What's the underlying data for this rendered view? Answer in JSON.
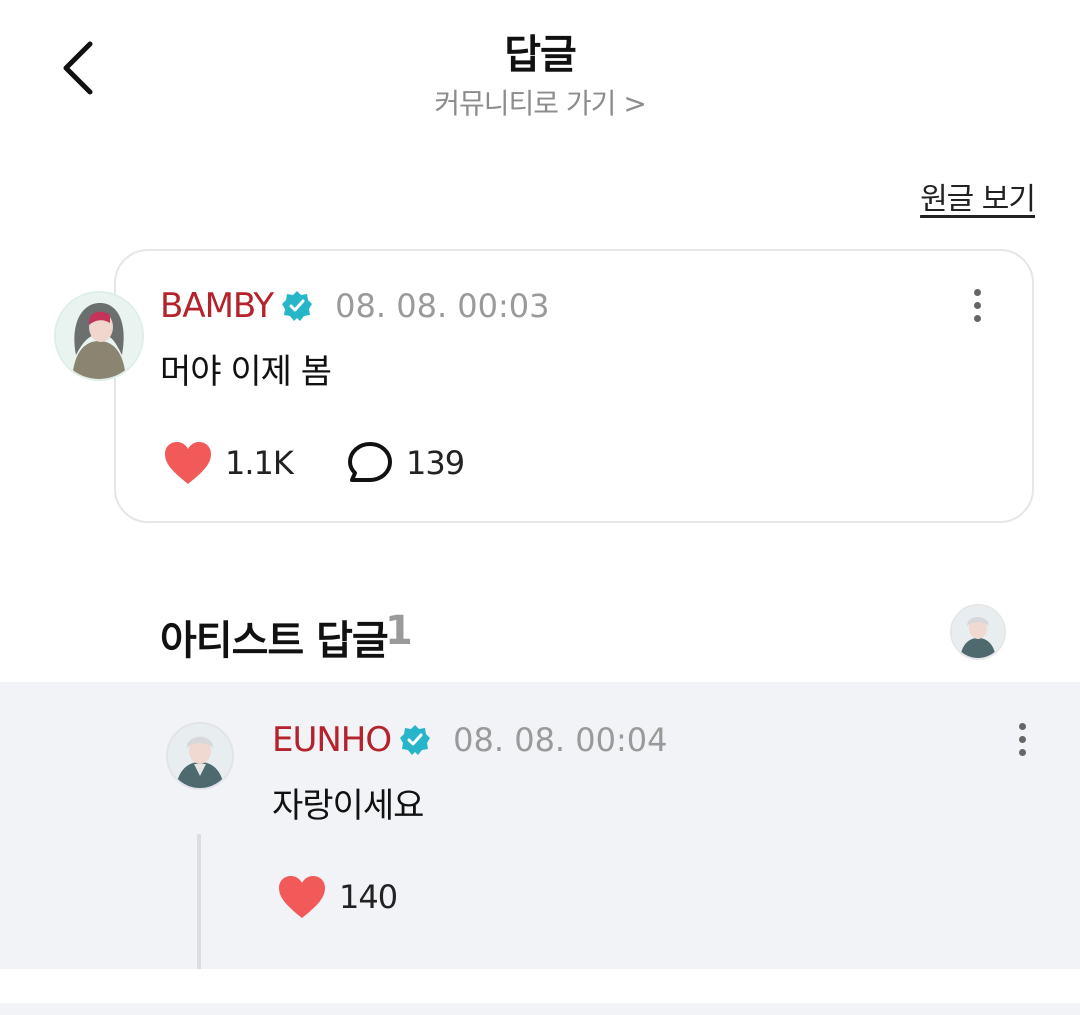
{
  "header": {
    "title": "답글",
    "subtitle": "커뮤니티로 가기 >"
  },
  "view_original_label": "원글 보기",
  "post": {
    "author": "BAMBY",
    "timestamp": "08. 08. 00:03",
    "text": "머야 이제 봄",
    "likes": "1.1K",
    "comments": "139"
  },
  "artist_replies": {
    "title": "아티스트 답글",
    "count": "1"
  },
  "reply": {
    "author": "EUNHO",
    "timestamp": "08. 08. 00:04",
    "text": "자랑이세요",
    "likes": "140"
  },
  "colors": {
    "author_name": "#b4222c",
    "verified_badge": "#27b5c9",
    "heart": "#f25a5a",
    "reply_background": "#f2f3f6"
  },
  "icons": [
    "back-arrow-icon",
    "verified-badge-icon",
    "more-options-icon",
    "heart-icon",
    "comment-bubble-icon"
  ]
}
